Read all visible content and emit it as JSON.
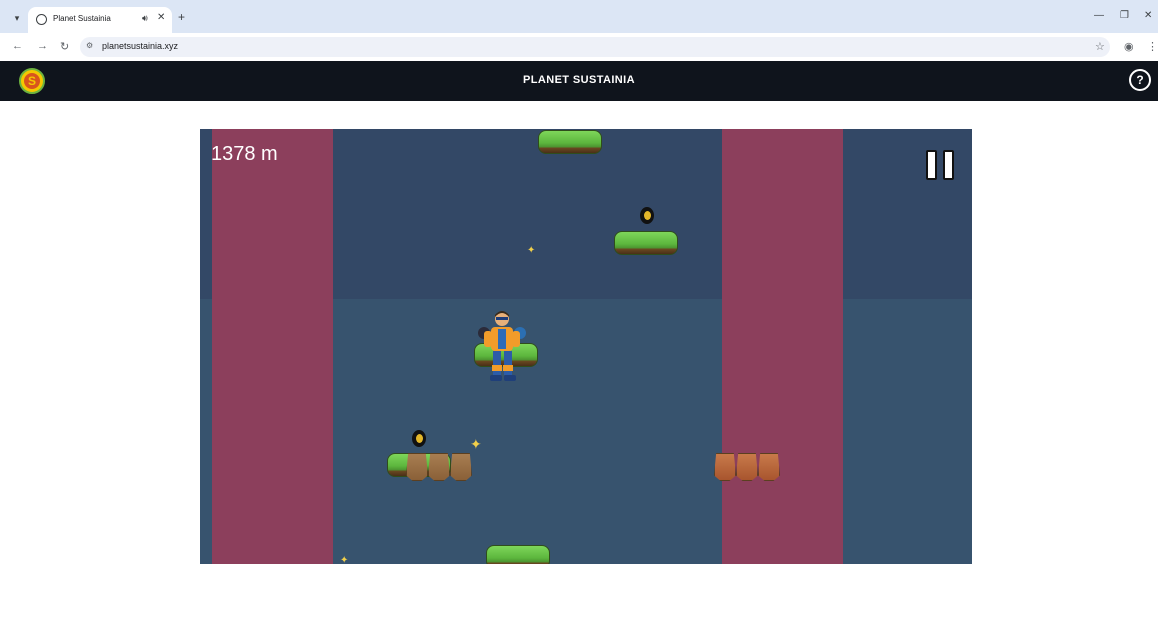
{
  "browser": {
    "tab_title": "Planet Sustainia",
    "url": "planetsustainia.xyz",
    "icons": {
      "tab_menu": "chevron-down-icon",
      "favicon": "globe-icon",
      "audio": "speaker-icon",
      "close": "close-icon",
      "new_tab": "plus-icon",
      "minimize": "minimize-icon",
      "restore": "restore-icon",
      "window_close": "close-icon",
      "back": "back-arrow-icon",
      "forward": "forward-arrow-icon",
      "reload": "reload-icon",
      "site_info": "tune-icon",
      "bookmark": "star-icon",
      "profile": "profile-icon",
      "menu": "kebab-menu-icon"
    }
  },
  "site": {
    "title": "PLANET SUSTAINIA",
    "logo_icon": "planet-sustainia-logo",
    "help_label": "?",
    "header_color": "#0f141c"
  },
  "game": {
    "distance": "1378 m",
    "pause_icon": "pause-icon",
    "colors": {
      "background": "#36506f",
      "danger_zone": "#8c3f5c",
      "platform": "#5cb63d"
    }
  }
}
